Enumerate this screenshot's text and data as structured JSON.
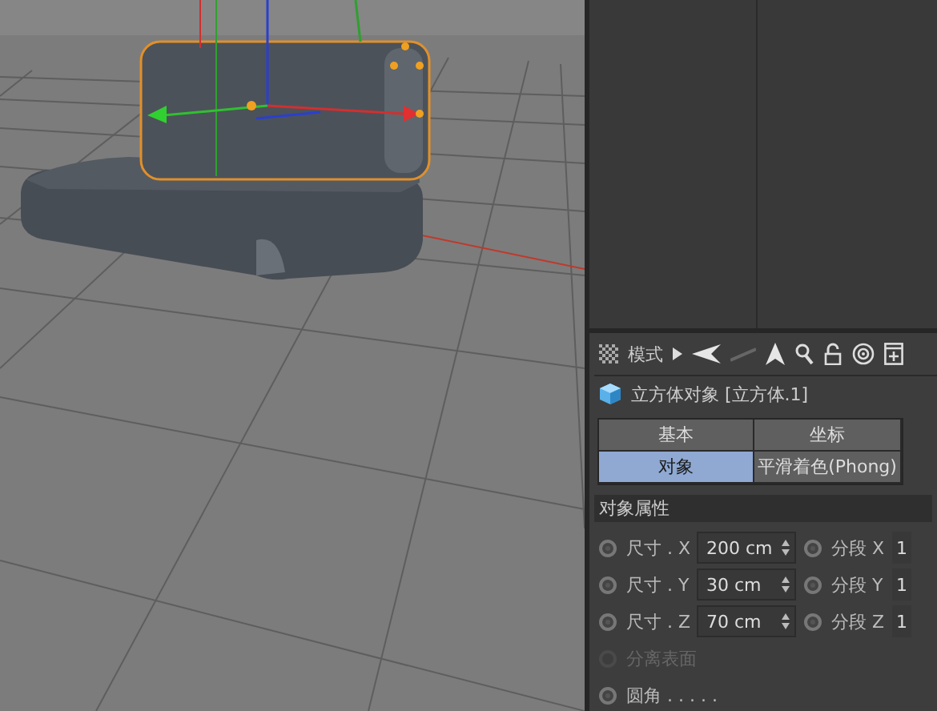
{
  "attributes": {
    "toolbar": {
      "mode_label": "模式"
    },
    "object_title": "立方体对象 [立方体.1]",
    "tabs": [
      {
        "label": "基本",
        "selected": false
      },
      {
        "label": "坐标",
        "selected": false
      },
      {
        "label": "对象",
        "selected": true
      },
      {
        "label": "平滑着色(Phong)",
        "selected": false
      }
    ],
    "section": "对象属性",
    "params": [
      {
        "kind": "pair",
        "label": "尺寸 . X",
        "keyed": false,
        "value": "200 cm",
        "label2": "分段 X",
        "keyed2": false,
        "value2": "1"
      },
      {
        "kind": "pair",
        "label": "尺寸 . Y",
        "keyed": false,
        "value": "30 cm",
        "label2": "分段 Y",
        "keyed2": false,
        "value2": "1"
      },
      {
        "kind": "pair",
        "label": "尺寸 . Z",
        "keyed": false,
        "value": "70 cm",
        "label2": "分段 Z",
        "keyed2": false,
        "value2": "1"
      },
      {
        "kind": "check",
        "label": "分离表面",
        "keyed": false,
        "disabled": true
      },
      {
        "kind": "check",
        "label": "圆角 . . . . .",
        "keyed": false,
        "disabled": false
      }
    ]
  }
}
